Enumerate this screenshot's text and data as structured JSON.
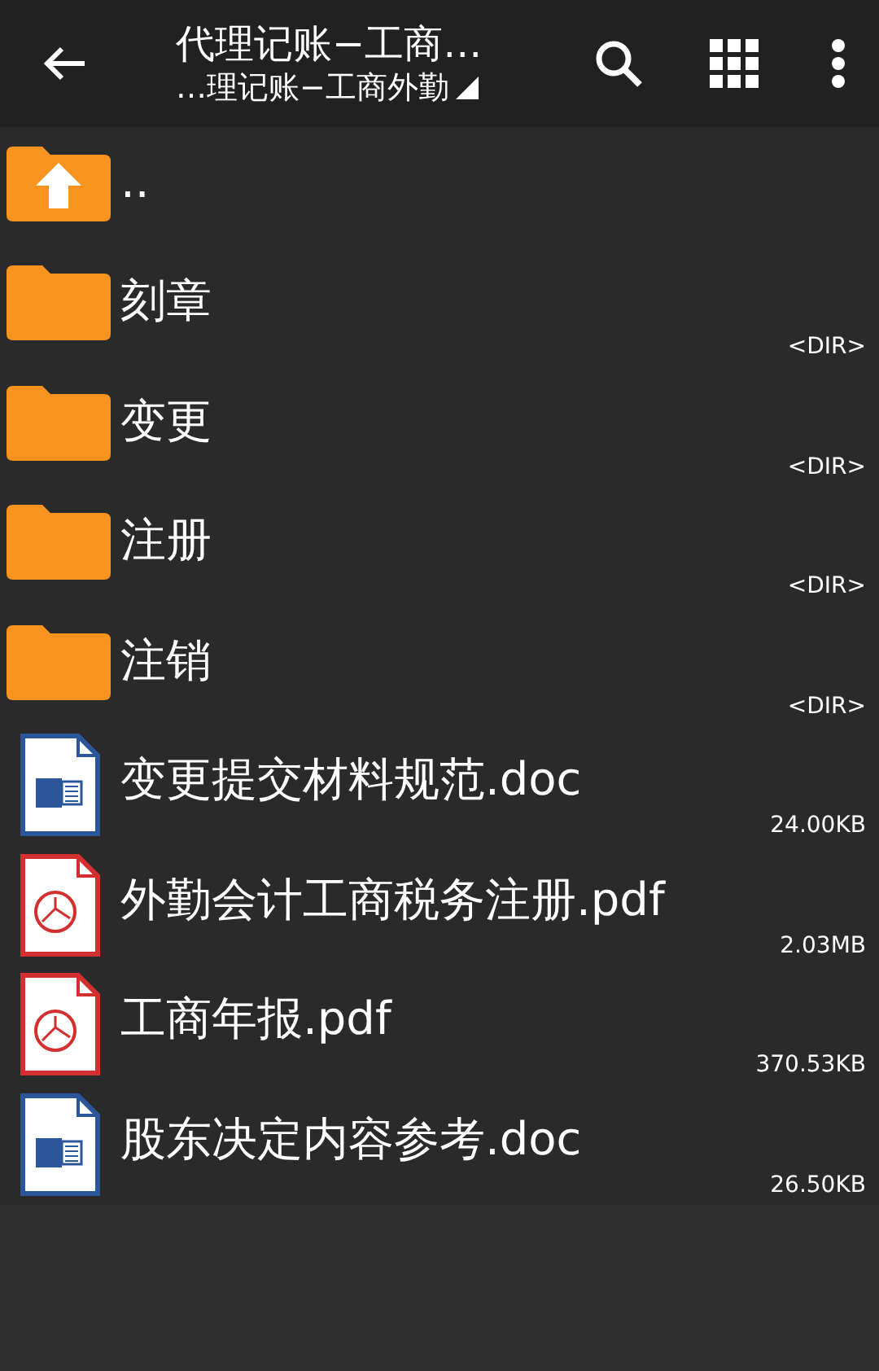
{
  "toolbar": {
    "title": "代理记账−工商…",
    "path": "…理记账−工商外勤"
  },
  "files": [
    {
      "kind": "parent",
      "name": ".."
    },
    {
      "kind": "folder",
      "name": "刻章",
      "size": "<DIR>"
    },
    {
      "kind": "folder",
      "name": "变更",
      "size": "<DIR>"
    },
    {
      "kind": "folder",
      "name": "注册",
      "size": "<DIR>"
    },
    {
      "kind": "folder",
      "name": "注销",
      "size": "<DIR>"
    },
    {
      "kind": "word",
      "name": "变更提交材料规范.doc",
      "size": "24.00KB"
    },
    {
      "kind": "pdf",
      "name": "外勤会计工商税务注册.pdf",
      "size": "2.03MB"
    },
    {
      "kind": "pdf",
      "name": "工商年报.pdf",
      "size": "370.53KB"
    },
    {
      "kind": "word",
      "name": "股东决定内容参考.doc",
      "size": "26.50KB"
    }
  ]
}
